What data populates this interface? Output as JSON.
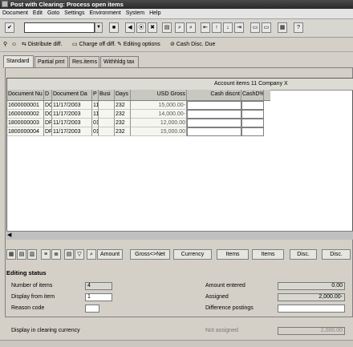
{
  "window": {
    "title": "Post with Clearing: Process open items"
  },
  "menu": [
    "Document",
    "Edit",
    "Goto",
    "Settings",
    "Environment",
    "System",
    "Help"
  ],
  "toolbar": {
    "command_value": ""
  },
  "actions": {
    "distribute": "Distribute diff.",
    "charge_off": "Charge off diff.",
    "editing_options": "Editing options",
    "cash_disc_due": "Cash Disc. Due"
  },
  "tabs": [
    "Standard",
    "Partial pmt",
    "Res.items",
    "Withhldg tax"
  ],
  "table": {
    "title": "Account items 11 Company X",
    "columns": [
      "Document Nu",
      "D",
      "Document Da",
      "P",
      "Busi",
      "Days",
      "USD Gross",
      "Cash discnt",
      "CashD%"
    ],
    "rows": [
      [
        "1600000001",
        "DG",
        "11/17/2003",
        "11",
        "",
        "232",
        "15,000.00-",
        "",
        ""
      ],
      [
        "1600000002",
        "DG",
        "11/17/2003",
        "11",
        "",
        "232",
        "14,000.00-",
        "",
        ""
      ],
      [
        "1800000003",
        "DR",
        "11/17/2003",
        "01",
        "",
        "232",
        "12,000.00",
        "",
        ""
      ],
      [
        "1800000004",
        "DR",
        "11/17/2003",
        "01",
        "",
        "232",
        "15,000.00",
        "",
        ""
      ]
    ]
  },
  "table_toolbar": {
    "amount": "Amount",
    "gross_net": "Gross<>Net",
    "currency": "Currency",
    "items1": "Items",
    "items2": "Items",
    "disc1": "Disc.",
    "disc2": "Disc."
  },
  "status": {
    "heading": "Editing status",
    "number_items_label": "Number of items",
    "number_items": "4",
    "display_from_label": "Display from item",
    "display_from": "1",
    "reason_code_label": "Reason code",
    "reason_code": "",
    "display_currency_label": "Display in clearing currency",
    "amount_entered_label": "Amount entered",
    "amount_entered": "0.00",
    "assigned_label": "Assigned",
    "assigned": "2,000.00-",
    "diff_postings_label": "Difference postings",
    "diff_postings": "",
    "not_assigned_label": "Not assigned",
    "not_assigned": "2,000.00"
  }
}
